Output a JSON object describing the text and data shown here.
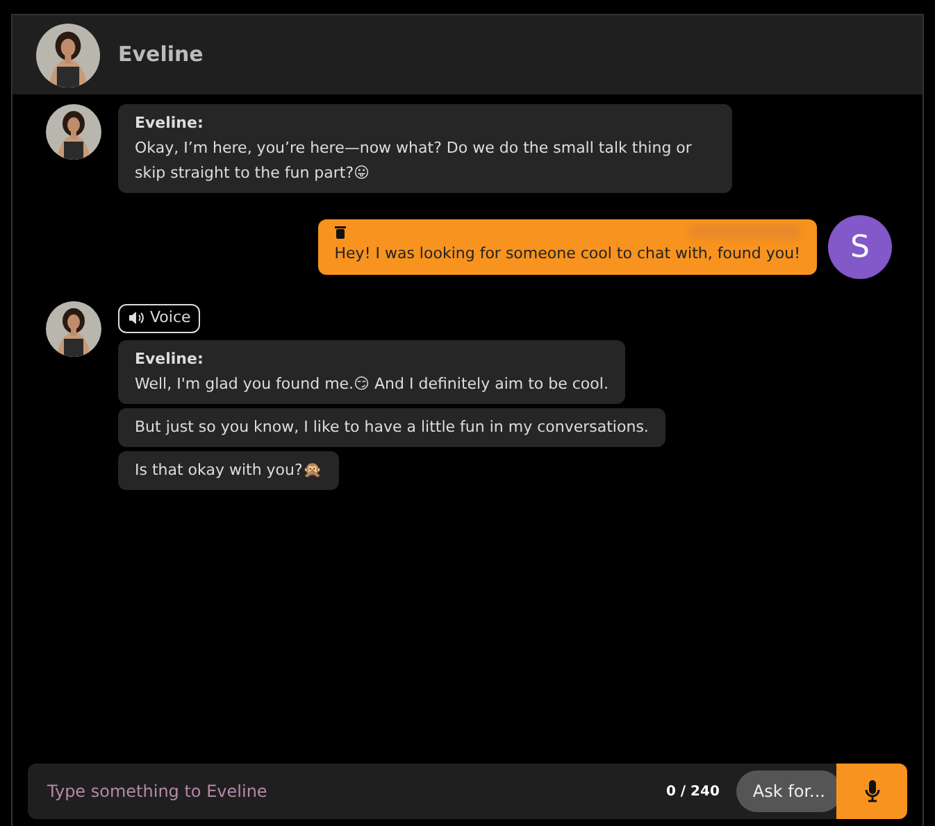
{
  "header": {
    "name": "Eveline"
  },
  "messages": [
    {
      "kind": "bot",
      "bubbles": [
        {
          "sender": "Eveline:",
          "text": "Okay, I’m here, you’re here—now what? Do we do the small talk thing or skip straight to the fun part?😛"
        }
      ]
    },
    {
      "kind": "user",
      "initial": "S",
      "text": "Hey! I was looking for someone cool to chat with, found you!"
    },
    {
      "kind": "bot",
      "voice": "Voice",
      "bubbles": [
        {
          "sender": "Eveline:",
          "text": "Well, I'm glad you found me.😏 And I definitely aim to be cool."
        },
        {
          "text": "But just so you know, I like to have a little fun in my conversations."
        },
        {
          "text": "Is that okay with you?🙊"
        }
      ]
    }
  ],
  "composer": {
    "placeholder": "Type something to Eveline",
    "counter": "0 / 240",
    "ask_button": "Ask for..."
  }
}
